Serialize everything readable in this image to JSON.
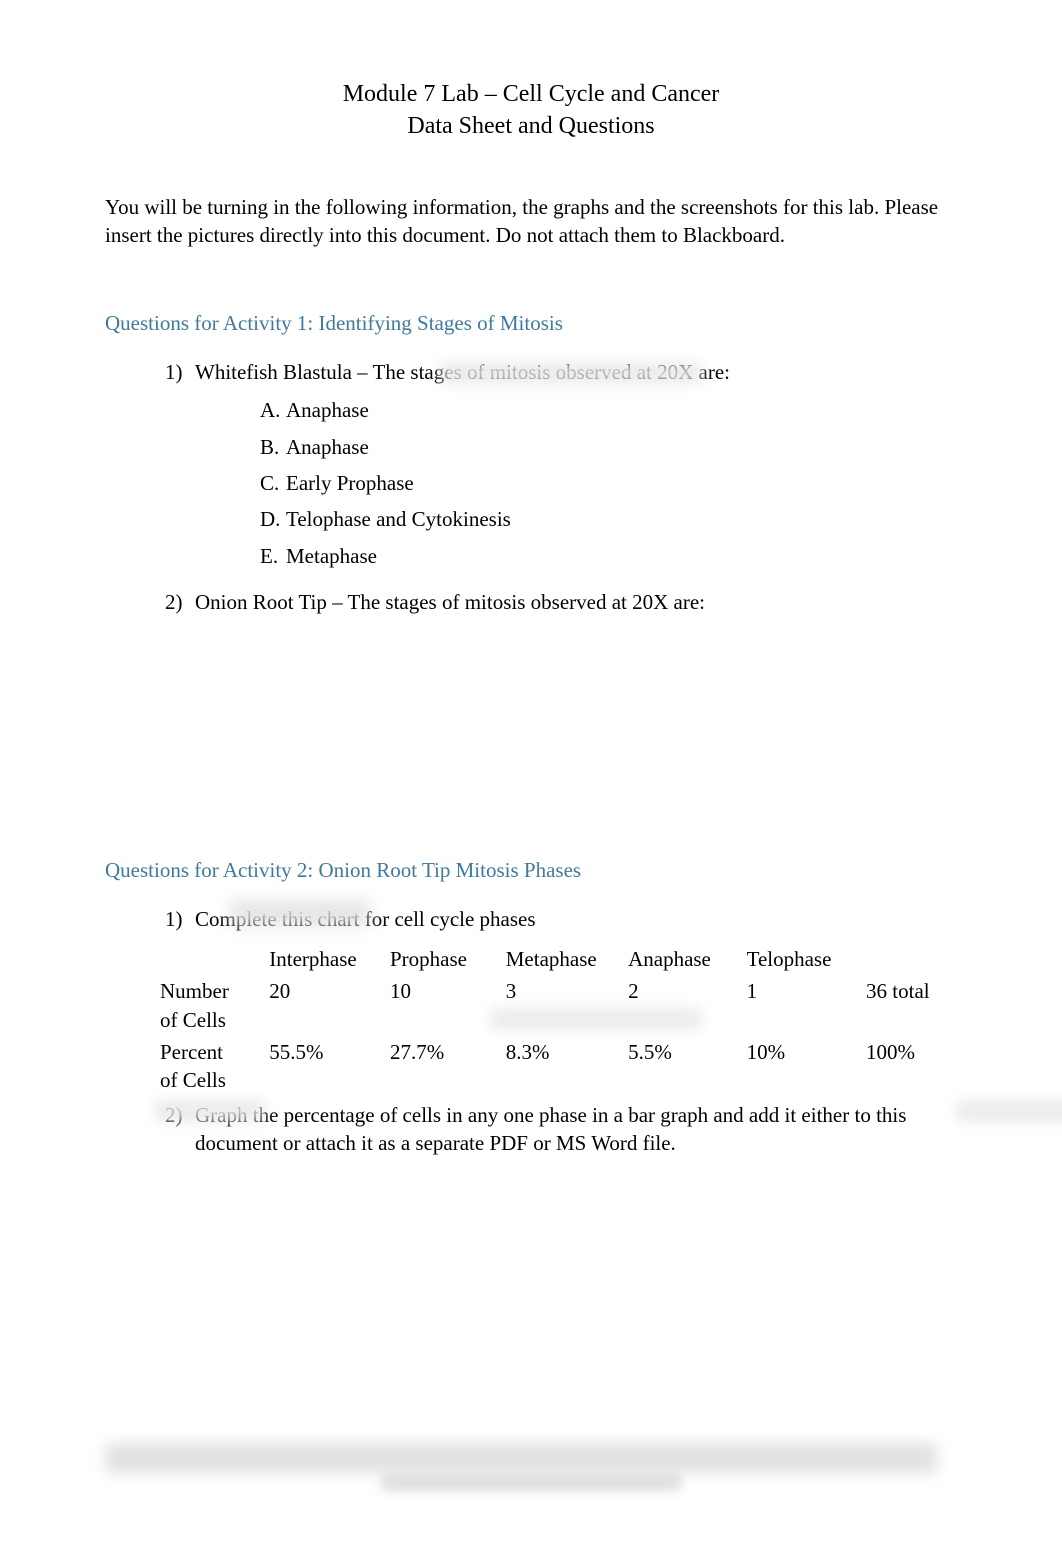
{
  "title": {
    "line1": "Module 7 Lab – Cell Cycle and Cancer",
    "line2": "Data Sheet and Questions"
  },
  "intro": {
    "part1": "You will be turning in the following information, the ",
    "graphs": "graphs",
    "part2": " and the ",
    "screenshots": "screenshots",
    "part3": " for this lab. Please ",
    "insert": "insert",
    "part4": " the pictures directly into this document. Do not attach them to Blackboard."
  },
  "activity1": {
    "heading": "Questions for Activity 1: Identifying Stages of Mitosis",
    "q1": {
      "num": "1)",
      "text": "Whitefish Blastula – The stages of mitosis observed at 20X are:",
      "items": {
        "a": {
          "letter": "A.",
          "text": "Anaphase"
        },
        "b": {
          "letter": "B.",
          "text": "Anaphase"
        },
        "c": {
          "letter": "C.",
          "text": "Early Prophase"
        },
        "d": {
          "letter": "D.",
          "text": "Telophase and Cytokinesis"
        },
        "e": {
          "letter": "E.",
          "text": "Metaphase"
        }
      }
    },
    "q2": {
      "num": "2)",
      "text": "Onion Root Tip – The stages of mitosis observed at 20X are:"
    }
  },
  "activity2": {
    "heading": "Questions for Activity 2: Onion Root Tip Mitosis Phases",
    "q1": {
      "num": "1)",
      "text": "Complete this chart for cell cycle phases"
    },
    "table": {
      "headers": {
        "interphase": "Interphase",
        "prophase": "Prophase",
        "metaphase": "Metaphase",
        "anaphase": "Anaphase",
        "telophase": "Telophase"
      },
      "row1": {
        "label": "Number of Cells",
        "interphase": "20",
        "prophase": "10",
        "metaphase": "3",
        "anaphase": "2",
        "telophase": "1",
        "total": "36 total"
      },
      "row2": {
        "label": "Percent of Cells",
        "interphase": "55.5%",
        "prophase": "27.7%",
        "metaphase": "8.3%",
        "anaphase": "5.5%",
        "telophase": "10%",
        "total": "100%"
      }
    },
    "q2": {
      "num": "2)",
      "text": "Graph the percentage of cells in any one phase in a bar graph and add it either to this document or attach it as a separate PDF or MS Word file."
    }
  },
  "chart_data": {
    "type": "table",
    "title": "Cell Cycle Phases",
    "columns": [
      "",
      "Interphase",
      "Prophase",
      "Metaphase",
      "Anaphase",
      "Telophase",
      "Total"
    ],
    "rows": [
      {
        "label": "Number of Cells",
        "values": [
          20,
          10,
          3,
          2,
          1,
          36
        ]
      },
      {
        "label": "Percent of Cells",
        "values": [
          55.5,
          27.7,
          8.3,
          5.5,
          10,
          100
        ]
      }
    ]
  }
}
